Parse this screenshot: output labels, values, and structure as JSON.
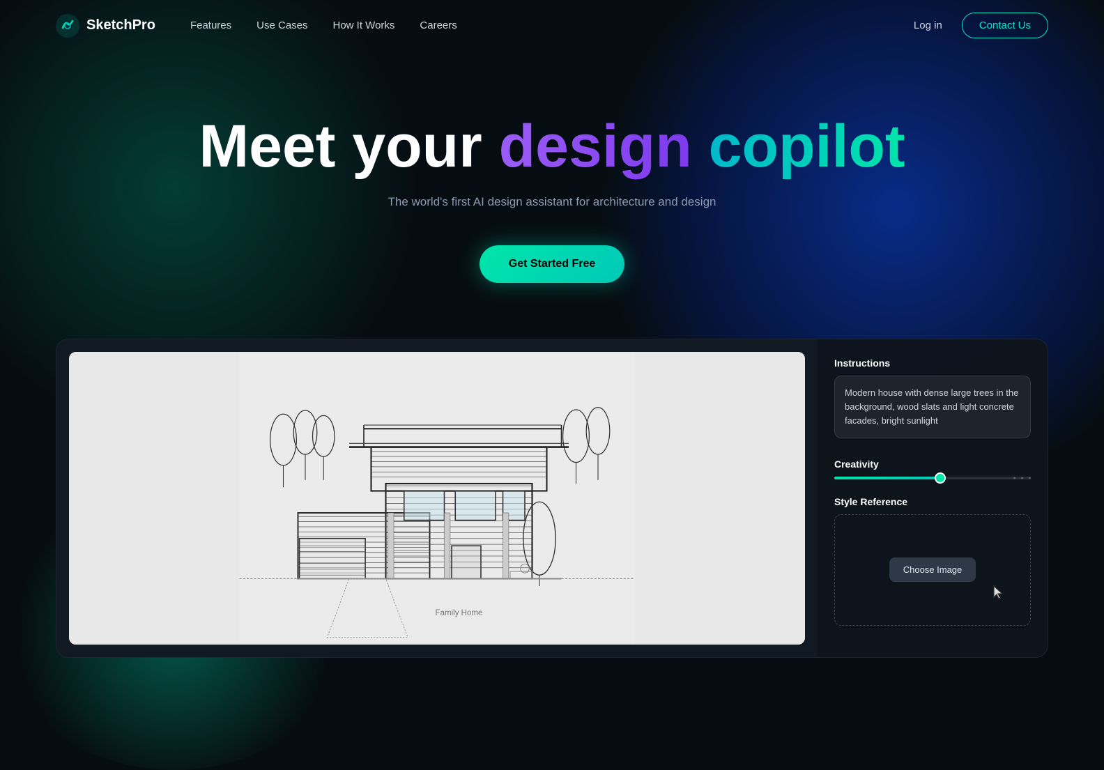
{
  "logo": {
    "text": "SketchPro"
  },
  "nav": {
    "links": [
      {
        "label": "Features",
        "name": "features"
      },
      {
        "label": "Use Cases",
        "name": "use-cases"
      },
      {
        "label": "How It Works",
        "name": "how-it-works"
      },
      {
        "label": "Careers",
        "name": "careers"
      }
    ],
    "login": "Log in",
    "contact": "Contact Us"
  },
  "hero": {
    "title_start": "Meet your ",
    "title_design": "design",
    "title_mid": " ",
    "title_copilot": "copilot",
    "subtitle": "The world's first AI design assistant for architecture and design",
    "cta": "Get Started Free"
  },
  "demo": {
    "instructions_label": "Instructions",
    "instructions_value": "Modern house with dense large trees in the background, wood slats and light concrete facades, bright sunlight",
    "creativity_label": "Creativity",
    "creativity_value": 54,
    "style_reference_label": "Style Reference",
    "choose_image_label": "Choose Image"
  }
}
